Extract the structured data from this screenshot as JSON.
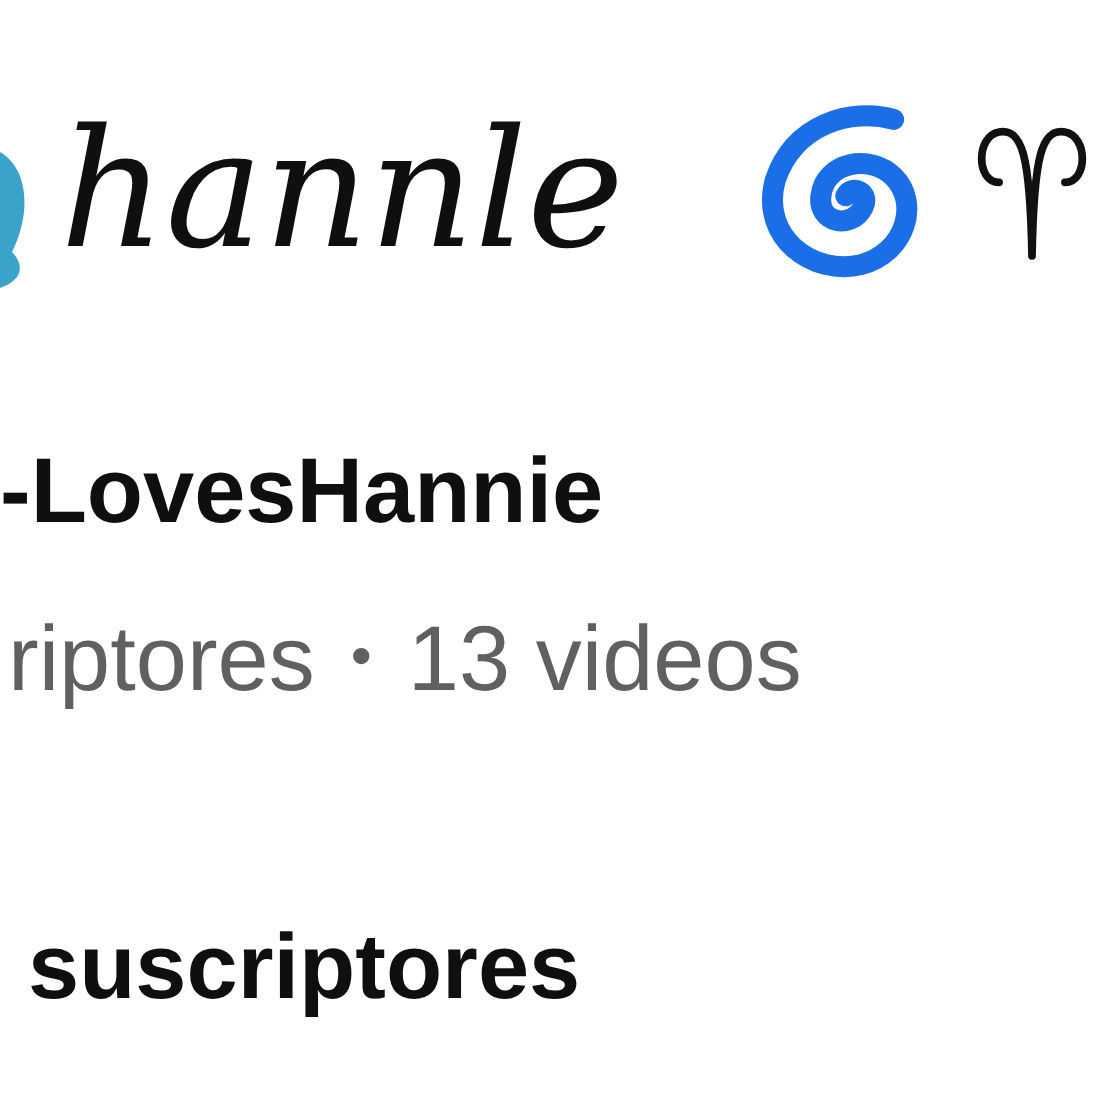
{
  "channel": {
    "name": "hannle",
    "handle": "-LovesHannie",
    "stats": "riptores",
    "separator": "•",
    "videos": "13 videos"
  },
  "section": {
    "title": "suscriptores"
  }
}
